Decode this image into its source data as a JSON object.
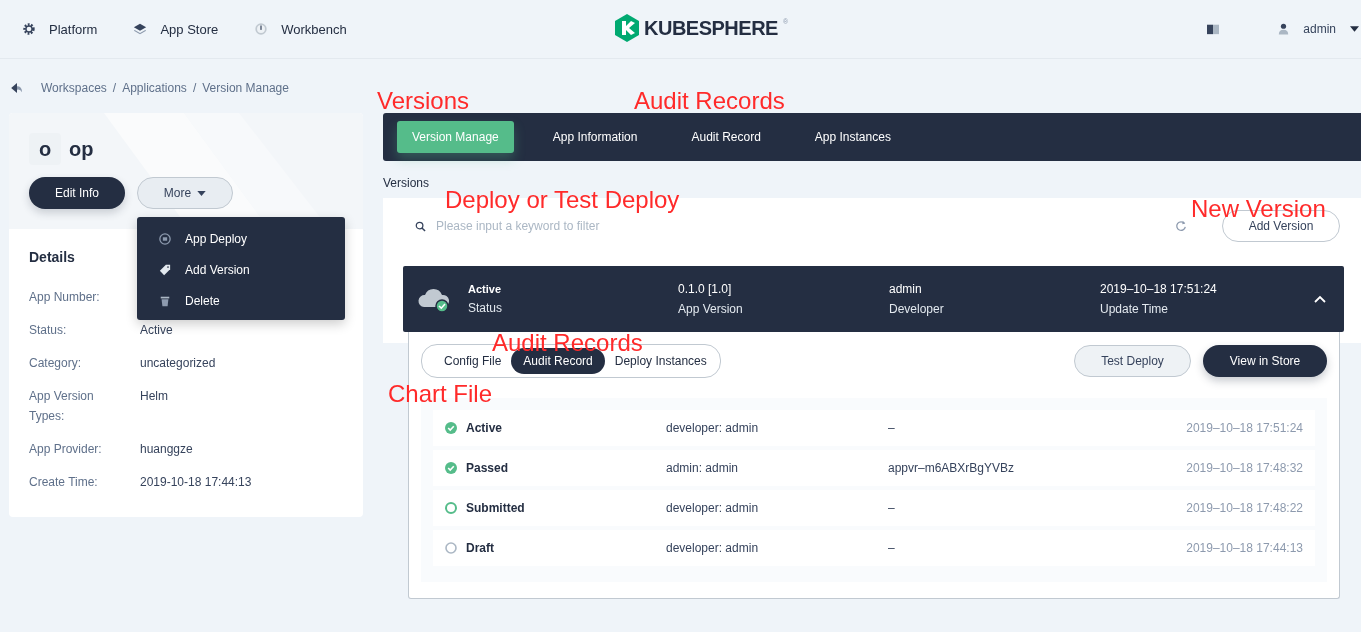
{
  "nav": {
    "items": [
      {
        "label": "Platform",
        "kind": "gear"
      },
      {
        "label": "App Store",
        "kind": "layers"
      },
      {
        "label": "Workbench",
        "kind": "dial"
      }
    ],
    "logo": "KUBESPHERE",
    "logo_mark": "®",
    "user": "admin"
  },
  "breadcrumb": {
    "items": [
      "Workspaces",
      "Applications",
      "Version Manage"
    ],
    "separator": "/"
  },
  "app": {
    "avatar": "o",
    "name": "op",
    "edit_button": "Edit Info",
    "more_button": "More"
  },
  "more_menu": [
    {
      "label": "App Deploy",
      "kind": "deploy"
    },
    {
      "label": "Add Version",
      "kind": "tag"
    },
    {
      "label": "Delete",
      "kind": "trash"
    }
  ],
  "details": {
    "title": "Details",
    "fields": [
      {
        "label": "App Number:"
      },
      {
        "label": "Status:",
        "value": "Active"
      },
      {
        "label": "Category:",
        "value": "uncategorized"
      },
      {
        "label": "App Version Types:",
        "value": "Helm"
      },
      {
        "label": "App Provider:",
        "value": "huanggze"
      },
      {
        "label": "Create Time:",
        "value": "2019-10-18 17:44:13"
      }
    ]
  },
  "tabs": [
    {
      "label": "Version Manage",
      "selected": true
    },
    {
      "label": "App Information",
      "selected": false
    },
    {
      "label": "Audit Record",
      "selected": false
    },
    {
      "label": "App Instances",
      "selected": false
    }
  ],
  "section_title": "Versions",
  "search": {
    "placeholder": "Please input a keyword to filter"
  },
  "add_button": "Add Version",
  "version": {
    "fields": [
      {
        "value": "Active",
        "label": "Status"
      },
      {
        "value": "0.1.0 [1.0]",
        "label": "App Version"
      },
      {
        "value": "admin",
        "label": "Developer"
      },
      {
        "value": "2019–10–18 17:51:24",
        "label": "Update Time"
      }
    ],
    "expanded": true
  },
  "subtabs": [
    {
      "label": "Config File",
      "selected": false
    },
    {
      "label": "Audit Record",
      "selected": true
    },
    {
      "label": "Deploy Instances",
      "selected": false
    }
  ],
  "actions": [
    {
      "label": "Test Deploy",
      "kind": "secondary"
    },
    {
      "label": "View in Store",
      "kind": "primary"
    }
  ],
  "audit_rows": [
    {
      "status": "Active",
      "kind": "done",
      "operator": "developer: admin",
      "message": "–",
      "time": "2019–10–18 17:51:24"
    },
    {
      "status": "Passed",
      "kind": "done",
      "operator": "admin: admin",
      "message": "appvr–m6ABXrBgYVBz",
      "time": "2019–10–18 17:48:32"
    },
    {
      "status": "Submitted",
      "kind": "pending",
      "operator": "developer: admin",
      "message": "–",
      "time": "2019–10–18 17:48:22"
    },
    {
      "status": "Draft",
      "kind": "draft",
      "operator": "developer: admin",
      "message": "–",
      "time": "2019–10–18 17:44:13"
    }
  ],
  "annotations": [
    "Versions",
    "Audit Records",
    "Deploy or Test Deploy",
    "New Version",
    "Audit Records",
    "Chart File"
  ]
}
